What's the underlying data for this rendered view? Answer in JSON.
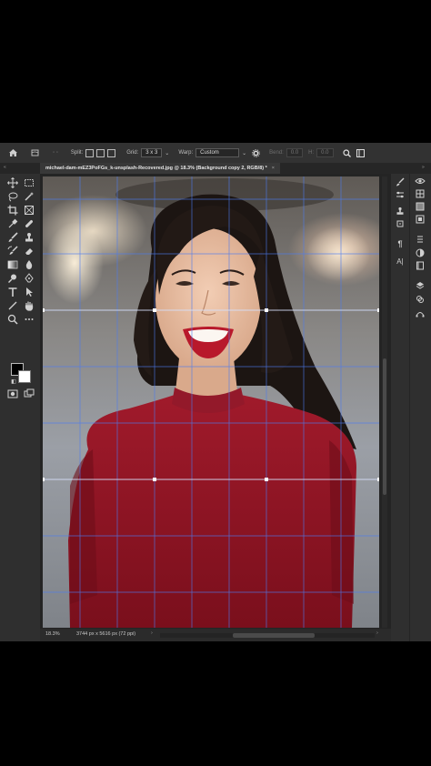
{
  "options_bar": {
    "split_label": "Split:",
    "grid_label": "Grid:",
    "grid_value": "3 x 3",
    "warp_label": "Warp:",
    "warp_value": "Custom",
    "bend_label": "Bend:",
    "bend_value": "0.0",
    "h_label": "H:",
    "h_value": "0.0"
  },
  "document_tab": {
    "title": "michael-dam-mEZ3PoFGs_k-unsplash-Recovered.jpg @ 18.3% (Background copy 2, RGB/8) *",
    "close": "×"
  },
  "status_bar": {
    "zoom": "18.3%",
    "doc_size": "3744 px x 5616 px (72 ppi)",
    "left_arrow": "›",
    "scroll_left": "‹",
    "scroll_right": "›"
  },
  "colors": {
    "panel_bg": "#2b2b2b",
    "toolbar_bg": "#2f2f2f",
    "grid_line": "#4d7bf0",
    "sweater": "#8c1422"
  },
  "icons": {
    "home": "home-icon",
    "move": "move-tool-icon",
    "marquee": "rectangular-marquee-icon",
    "lasso": "lasso-icon",
    "magic_wand": "quick-selection-icon",
    "crop": "crop-icon",
    "frame": "frame-icon",
    "eyedropper": "eyedropper-icon",
    "healing": "spot-healing-icon",
    "brush": "brush-icon",
    "stamp": "clone-stamp-icon",
    "history": "history-brush-icon",
    "eraser": "eraser-icon",
    "gradient": "gradient-icon",
    "blur": "blur-icon",
    "dodge": "dodge-icon",
    "pen": "pen-icon",
    "type": "type-tool-icon",
    "path": "path-selection-icon",
    "line": "line-tool-icon",
    "hand": "hand-tool-icon",
    "zoom": "zoom-tool-icon",
    "more": "more-tools-icon",
    "quickmask": "quick-mask-icon",
    "screenmode": "screen-mode-icon"
  }
}
